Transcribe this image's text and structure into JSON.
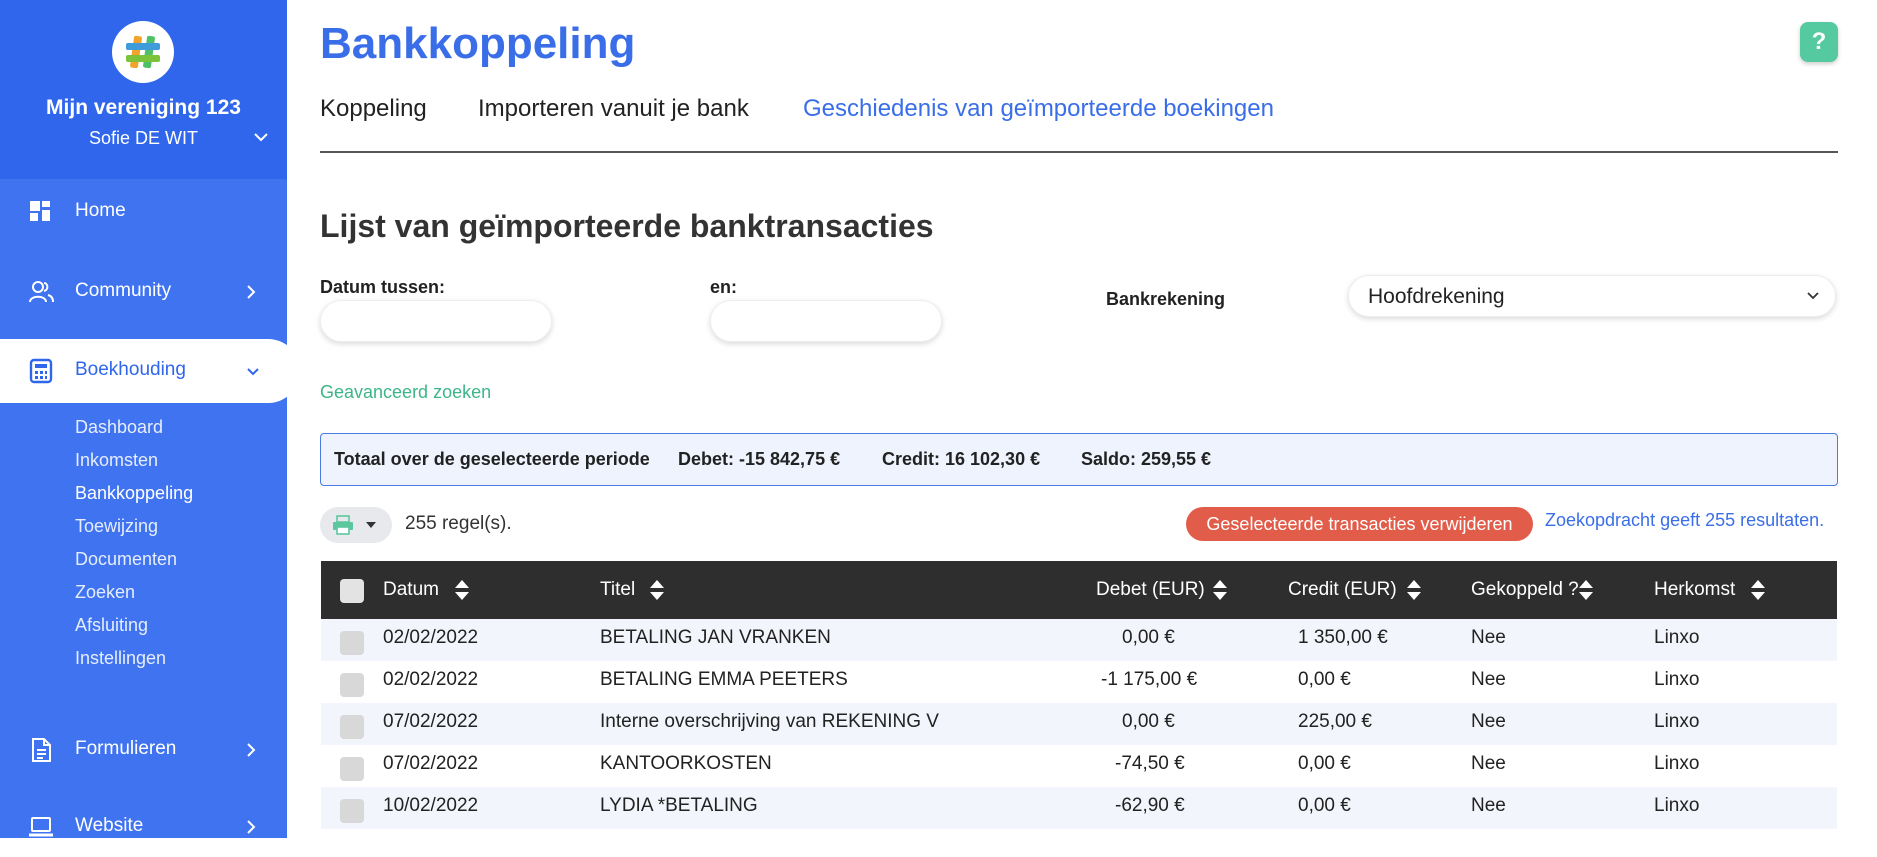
{
  "sidebar": {
    "org_name": "Mijn vereniging 123",
    "user_name": "Sofie DE WIT",
    "nav": [
      {
        "label": "Home",
        "icon": "dashboard-icon"
      },
      {
        "label": "Community",
        "icon": "users-icon"
      },
      {
        "label": "Boekhouding",
        "icon": "calculator-icon"
      },
      {
        "label": "Formulieren",
        "icon": "document-icon"
      },
      {
        "label": "Website",
        "icon": "laptop-icon"
      }
    ],
    "sub_items": [
      "Dashboard",
      "Inkomsten",
      "Bankkoppeling",
      "Toewijzing",
      "Documenten",
      "Zoeken",
      "Afsluiting",
      "Instellingen"
    ]
  },
  "header": {
    "title": "Bankkoppeling",
    "help_label": "?"
  },
  "tabs": [
    "Koppeling",
    "Importeren vanuit je bank",
    "Geschiedenis van geïmporteerde boekingen"
  ],
  "section_title": "Lijst van geïmporteerde banktransacties",
  "filters": {
    "date_between_label": "Datum tussen:",
    "and_label": "en:",
    "bank_account_label": "Bankrekening",
    "bank_account_value": "Hoofdrekening",
    "advanced_search": "Geavanceerd zoeken"
  },
  "totals": {
    "label": "Totaal over de geselecteerde periode",
    "debet": "Debet: -15 842,75 €",
    "credit": "Credit: 16 102,30 €",
    "saldo": "Saldo: 259,55 €"
  },
  "toolbar": {
    "rows_count": "255 regel(s).",
    "delete_button": "Geselecteerde transacties verwijderen",
    "results_text": "Zoekopdracht geeft 255 resultaten."
  },
  "table": {
    "columns": [
      "Datum",
      "Titel",
      "Debet (EUR)",
      "Credit (EUR)",
      "Gekoppeld ?",
      "Herkomst"
    ],
    "rows": [
      {
        "datum": "02/02/2022",
        "titel": "BETALING JAN VRANKEN",
        "debet": "0,00 €",
        "credit": "1 350,00 €",
        "gekoppeld": "Nee",
        "herkomst": "Linxo"
      },
      {
        "datum": "02/02/2022",
        "titel": "BETALING EMMA PEETERS",
        "debet": "-1 175,00 €",
        "credit": "0,00 €",
        "gekoppeld": "Nee",
        "herkomst": "Linxo"
      },
      {
        "datum": "07/02/2022",
        "titel": "Interne overschrijving van REKENING V",
        "debet": "0,00 €",
        "credit": "225,00 €",
        "gekoppeld": "Nee",
        "herkomst": "Linxo"
      },
      {
        "datum": "07/02/2022",
        "titel": "KANTOORKOSTEN",
        "debet": "-74,50 €",
        "credit": "0,00 €",
        "gekoppeld": "Nee",
        "herkomst": "Linxo"
      },
      {
        "datum": "10/02/2022",
        "titel": "LYDIA *BETALING",
        "debet": "-62,90 €",
        "credit": "0,00 €",
        "gekoppeld": "Nee",
        "herkomst": "Linxo"
      }
    ]
  },
  "colors": {
    "sidebar": "#3f73f0",
    "accent": "#3a6ee8",
    "green": "#3cb688",
    "danger": "#e15d4a",
    "table_header": "#2e2e2e"
  }
}
